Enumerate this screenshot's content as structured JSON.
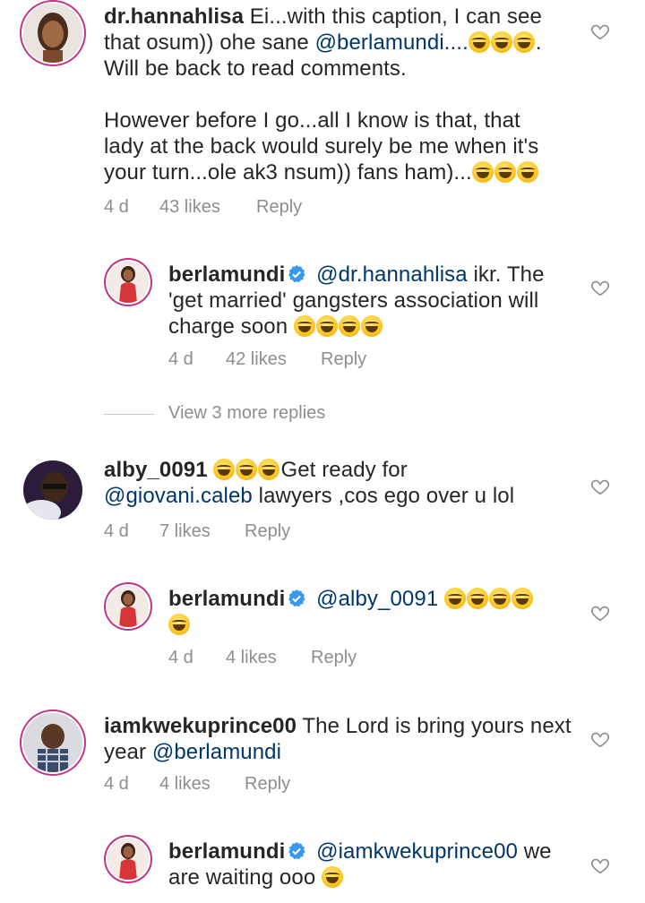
{
  "comments": [
    {
      "username": "dr.hannahlisa",
      "lines": [
        {
          "text": "Ei...with this caption, I can see"
        },
        {
          "text": "that osum)) ohe sane ",
          "mention": "@berlamundi....",
          "after": "."
        },
        {
          "text": "Will be back to read comments."
        },
        {
          "text": ""
        },
        {
          "text": "However before I go...all I know is that, that"
        },
        {
          "text": "lady at the back would surely be me when it's"
        },
        {
          "text": "your turn...ole ak3 nsum)) fans ham)..."
        }
      ],
      "age": "4 d",
      "likes": "43 likes",
      "reply": "Reply"
    },
    {
      "username": "berlamundi",
      "mention": "@dr.hannahlisa",
      "text1": " ikr. The",
      "line2": "'get married'  gangsters association will",
      "line3": "charge soon",
      "age": "4 d",
      "likes": "42 likes",
      "reply": "Reply"
    },
    {
      "view_more": "View 3 more replies"
    },
    {
      "username": "alby_0091",
      "text1": "Get ready for",
      "mention": "@giovani.caleb",
      "text2": " lawyers ,cos ego over u lol",
      "age": "4 d",
      "likes": "7 likes",
      "reply": "Reply"
    },
    {
      "username": "berlamundi",
      "mention": "@alby_0091",
      "age": "4 d",
      "likes": "4 likes",
      "reply": "Reply"
    },
    {
      "username": "iamkwekuprince00",
      "text1": " The Lord is bring yours next",
      "text2": "year ",
      "mention": "@berlamundi",
      "age": "4 d",
      "likes": "4 likes",
      "reply": "Reply"
    },
    {
      "username": "berlamundi",
      "mention": "@iamkwekuprince00",
      "text1": " we",
      "text2": "are  waiting ooo"
    }
  ],
  "colors": {
    "mention": "#00376b",
    "meta": "#8e8e8e",
    "verified": "#3897f0"
  },
  "icons": {
    "like": "heart-outline-icon",
    "verified": "verified-badge-icon",
    "emoji": "laughing-face-emoji"
  }
}
